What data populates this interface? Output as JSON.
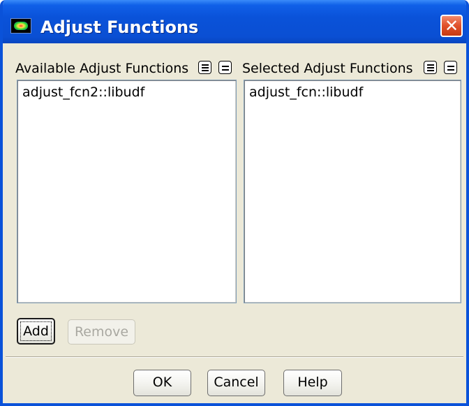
{
  "window": {
    "title": "Adjust Functions",
    "close_symbol": "✕"
  },
  "available": {
    "label": "Available Adjust Functions",
    "items": [
      "adjust_fcn2::libudf"
    ],
    "select_all_icon": "select-all-icon",
    "deselect_all_icon": "deselect-all-icon"
  },
  "selected": {
    "label": "Selected Adjust Functions",
    "items": [
      "adjust_fcn::libudf"
    ],
    "select_all_icon": "select-all-icon",
    "deselect_all_icon": "deselect-all-icon"
  },
  "actions": {
    "add_label": "Add",
    "remove_label": "Remove"
  },
  "footer": {
    "ok_label": "OK",
    "cancel_label": "Cancel",
    "help_label": "Help"
  },
  "colors": {
    "titlebar": "#0a52d9",
    "close_button": "#e0502a",
    "dialog_background": "#ece9d8"
  }
}
